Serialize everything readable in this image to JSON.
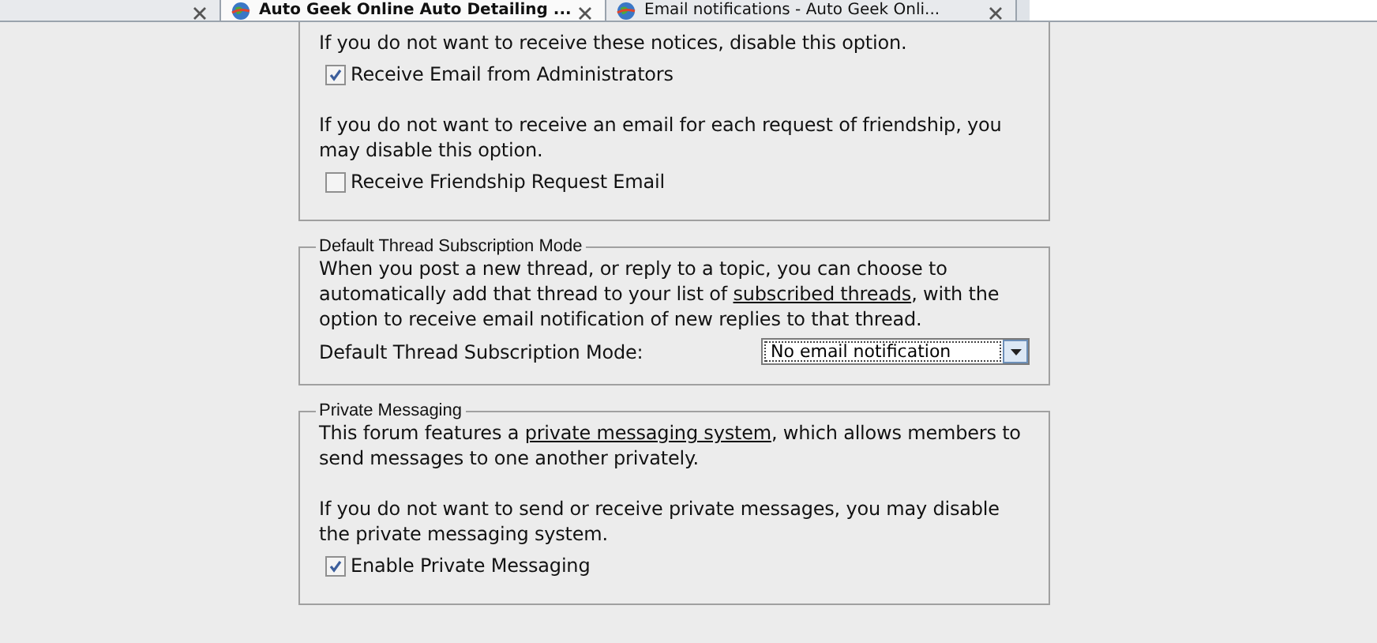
{
  "tabs": [
    {
      "selected": false
    },
    {
      "label": "Auto Geek Online Auto Detailing ...",
      "selected": true
    },
    {
      "label": "Email notifications - Auto Geek Onli...",
      "selected": false
    }
  ],
  "sections": [
    {
      "items": [
        {
          "kind": "text",
          "text": "If you do not want to receive these notices, disable this option."
        },
        {
          "kind": "checkbox",
          "label": "Receive Email from Administrators",
          "checked": true
        },
        {
          "kind": "text",
          "text": "If you do not want to receive an email for each request of friendship, you may disable this option."
        },
        {
          "kind": "checkbox",
          "label": "Receive Friendship Request Email",
          "checked": false
        }
      ]
    },
    {
      "legend": "Default Thread Subscription Mode",
      "items": [
        {
          "kind": "text",
          "text": "When you post a new thread, or reply to a topic, you can choose to automatically add that thread to your list of ",
          "link": "subscribed threads",
          "after": ", with the option to receive email notification of new replies to that thread."
        },
        {
          "kind": "select",
          "label": "Default Thread Subscription Mode:",
          "value": "No email notification"
        }
      ]
    },
    {
      "legend": "Private Messaging",
      "items": [
        {
          "kind": "text",
          "text": "This forum features a ",
          "link": "private messaging system",
          "after": ", which allows members to send messages to one another privately."
        },
        {
          "kind": "text",
          "text": "If you do not want to send or receive private messages, you may disable the private messaging system."
        },
        {
          "kind": "checkbox",
          "label": "Enable Private Messaging",
          "checked": true
        }
      ]
    }
  ]
}
